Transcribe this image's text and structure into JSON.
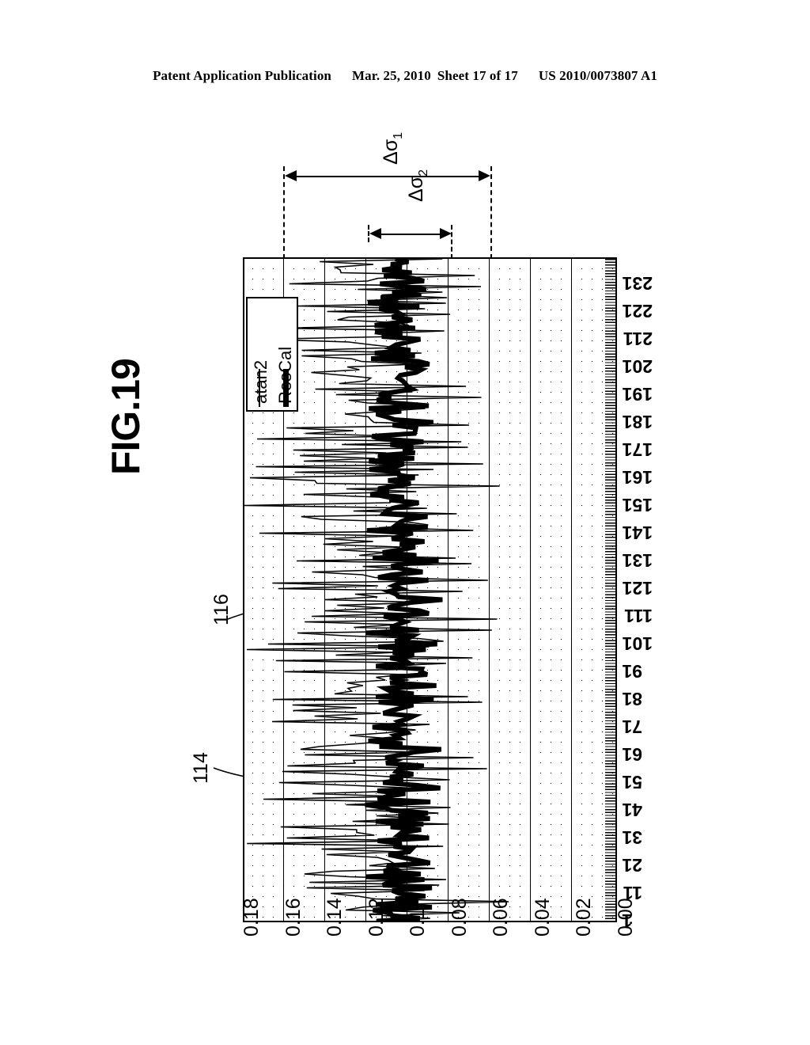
{
  "header": {
    "publication": "Patent Application Publication",
    "date": "Mar. 25, 2010",
    "sheet": "Sheet 17 of 17",
    "patent_number": "US 2010/0073807 A1"
  },
  "figure": {
    "title": "FIG.19",
    "reference_numerals": [
      {
        "label": "114"
      },
      {
        "label": "116"
      }
    ],
    "annotations": [
      {
        "label": "Δσ",
        "subscript": "1"
      },
      {
        "label": "Δσ",
        "subscript": "2"
      }
    ]
  },
  "chart_data": {
    "type": "line",
    "title": "FIG.19",
    "orientation": "rotated-90",
    "xlabel": "",
    "ylabel": "",
    "grid": true,
    "legend_position": "top-left-inside",
    "ylim": [
      0.0,
      0.18
    ],
    "yticks": [
      "0.18",
      "0.16",
      "0.14",
      "0.12",
      "0.1",
      "0.08",
      "0.06",
      "0.04",
      "0.02",
      "0.00"
    ],
    "xlim": [
      1,
      241
    ],
    "xticks": [
      "1",
      "11",
      "21",
      "31",
      "41",
      "51",
      "61",
      "71",
      "81",
      "91",
      "101",
      "111",
      "121",
      "131",
      "141",
      "151",
      "161",
      "171",
      "181",
      "191",
      "201",
      "211",
      "221",
      "231"
    ],
    "series": [
      {
        "name": "atan2",
        "style": "thin",
        "values": [
          0.12,
          0.148,
          0.101,
          0.133,
          0.093,
          0.152,
          0.108,
          0.141,
          0.086,
          0.129,
          0.113,
          0.157,
          0.096,
          0.138,
          0.104,
          0.146,
          0.089,
          0.131,
          0.118,
          0.15,
          0.099,
          0.142,
          0.087,
          0.127,
          0.11,
          0.155,
          0.094,
          0.136,
          0.106,
          0.148,
          0.091,
          0.13,
          0.116,
          0.153,
          0.098,
          0.14,
          0.085,
          0.125,
          0.112,
          0.147,
          0.103,
          0.139,
          0.09,
          0.132,
          0.119,
          0.151,
          0.097,
          0.143,
          0.088,
          0.128,
          0.114,
          0.156,
          0.095,
          0.137,
          0.105,
          0.149,
          0.092,
          0.134,
          0.117,
          0.152,
          0.1,
          0.144,
          0.086,
          0.126,
          0.111,
          0.154,
          0.093,
          0.135,
          0.107,
          0.145,
          0.089,
          0.129,
          0.115,
          0.15,
          0.102,
          0.141,
          0.084,
          0.124,
          0.113,
          0.148,
          0.096,
          0.138,
          0.091,
          0.133,
          0.118,
          0.153,
          0.099,
          0.142,
          0.087,
          0.127,
          0.11,
          0.146,
          0.094,
          0.136,
          0.108,
          0.151,
          0.09,
          0.131,
          0.116,
          0.155,
          0.097,
          0.139,
          0.085,
          0.125,
          0.112,
          0.149,
          0.095,
          0.137,
          0.104,
          0.144,
          0.088,
          0.13,
          0.119,
          0.152,
          0.101,
          0.14,
          0.086,
          0.128,
          0.115,
          0.147,
          0.093,
          0.134,
          0.106,
          0.15,
          0.092,
          0.132,
          0.117,
          0.154,
          0.098,
          0.143,
          0.084,
          0.126,
          0.111,
          0.145,
          0.096,
          0.138,
          0.103,
          0.148,
          0.089,
          0.129,
          0.114,
          0.151,
          0.1,
          0.141,
          0.087,
          0.127,
          0.109,
          0.146,
          0.094,
          0.135,
          0.105,
          0.153,
          0.091,
          0.133,
          0.118,
          0.149,
          0.097,
          0.142,
          0.085,
          0.124,
          0.113,
          0.15,
          0.099,
          0.137,
          0.102,
          0.147,
          0.09,
          0.131,
          0.116,
          0.152,
          0.095,
          0.139,
          0.086,
          0.128,
          0.11,
          0.144,
          0.093,
          0.136,
          0.107,
          0.155,
          0.088,
          0.13,
          0.115,
          0.148,
          0.101,
          0.14,
          0.084,
          0.125,
          0.112,
          0.146,
          0.096,
          0.134,
          0.104,
          0.151,
          0.092,
          0.132,
          0.119,
          0.143,
          0.098,
          0.127,
          0.109,
          0.149,
          0.087,
          0.135,
          0.117,
          0.153,
          0.1,
          0.138,
          0.089,
          0.126,
          0.111,
          0.147,
          0.094,
          0.133,
          0.106,
          0.15,
          0.091,
          0.129,
          0.114,
          0.145,
          0.097,
          0.141,
          0.085,
          0.13,
          0.108,
          0.152,
          0.093,
          0.136,
          0.118,
          0.148,
          0.099,
          0.128,
          0.103,
          0.144,
          0.09,
          0.134,
          0.113,
          0.154,
          0.096,
          0.14,
          0.086
        ]
      },
      {
        "name": "ResCal",
        "style": "thick",
        "values": [
          0.104,
          0.112,
          0.098,
          0.108,
          0.101,
          0.115,
          0.096,
          0.107,
          0.103,
          0.111,
          0.099,
          0.106,
          0.113,
          0.097,
          0.105,
          0.109,
          0.1,
          0.114,
          0.095,
          0.108,
          0.102,
          0.11,
          0.098,
          0.106,
          0.112,
          0.101,
          0.107,
          0.096,
          0.109,
          0.103,
          0.115,
          0.099,
          0.105,
          0.111,
          0.097,
          0.108,
          0.104,
          0.113,
          0.1,
          0.106,
          0.095,
          0.11,
          0.102,
          0.114,
          0.098,
          0.107,
          0.109,
          0.101,
          0.112,
          0.096,
          0.105,
          0.108,
          0.103,
          0.116,
          0.099,
          0.106,
          0.11,
          0.097,
          0.113,
          0.102,
          0.107,
          0.1,
          0.109,
          0.095,
          0.111,
          0.104,
          0.115,
          0.098,
          0.105,
          0.108,
          0.101,
          0.112,
          0.096,
          0.11,
          0.103,
          0.107,
          0.114,
          0.099,
          0.106,
          0.1,
          0.109,
          0.097,
          0.113,
          0.102,
          0.105,
          0.111,
          0.098,
          0.108,
          0.104,
          0.115,
          0.1,
          0.106,
          0.095,
          0.11,
          0.103,
          0.112,
          0.099,
          0.107,
          0.109,
          0.101,
          0.114,
          0.096,
          0.105,
          0.108,
          0.102,
          0.113,
          0.098,
          0.106,
          0.11,
          0.1,
          0.107,
          0.115,
          0.097,
          0.104,
          0.111,
          0.103,
          0.109,
          0.095,
          0.108,
          0.101,
          0.112,
          0.099,
          0.106,
          0.114,
          0.098,
          0.105,
          0.11,
          0.102,
          0.107,
          0.1,
          0.113,
          0.096,
          0.109,
          0.104,
          0.111,
          0.097,
          0.106,
          0.108,
          0.101,
          0.115,
          0.099,
          0.105,
          0.112,
          0.098,
          0.107,
          0.103,
          0.11,
          0.095,
          0.109,
          0.102,
          0.114,
          0.1,
          0.106,
          0.108,
          0.097,
          0.111,
          0.104,
          0.113,
          0.099,
          0.105,
          0.11,
          0.101,
          0.107,
          0.096,
          0.112,
          0.103,
          0.108,
          0.115,
          0.098,
          0.106,
          0.1,
          0.109,
          0.102,
          0.114,
          0.097,
          0.105,
          0.111,
          0.104,
          0.107,
          0.099,
          0.113,
          0.095,
          0.108,
          0.101,
          0.11,
          0.106,
          0.116,
          0.098,
          0.104,
          0.109,
          0.102,
          0.112,
          0.1,
          0.107,
          0.096,
          0.111,
          0.103,
          0.108,
          0.114,
          0.099,
          0.105,
          0.11,
          0.097,
          0.106,
          0.113,
          0.101,
          0.109,
          0.104,
          0.115,
          0.098,
          0.107,
          0.1,
          0.112,
          0.095,
          0.108,
          0.102,
          0.111,
          0.106,
          0.099,
          0.114,
          0.103,
          0.105,
          0.109,
          0.097,
          0.11,
          0.101,
          0.113,
          0.104,
          0.108,
          0.096,
          0.106,
          0.112,
          0.1,
          0.107,
          0.115,
          0.098,
          0.105,
          0.109,
          0.102,
          0.111,
          0.103
        ]
      }
    ],
    "legend": [
      {
        "label": "atan2"
      },
      {
        "label": "ResCal"
      }
    ]
  }
}
